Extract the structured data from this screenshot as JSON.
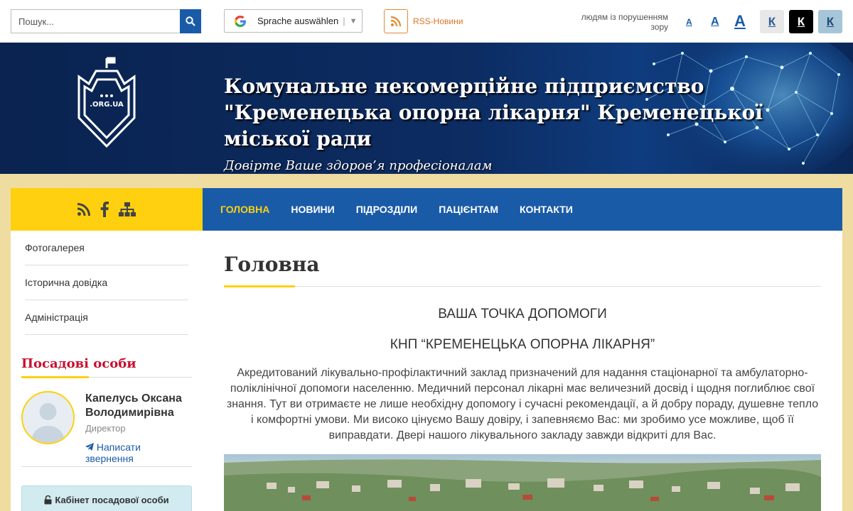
{
  "topbar": {
    "search_placeholder": "Пошук...",
    "translate_label": "Sprache auswählen",
    "rss_label": "RSS-Новини",
    "vision_label": "людям із порушенням зору",
    "font_small": "A",
    "font_medium": "A",
    "font_large": "A",
    "contrast_default": "К",
    "contrast_black": "К",
    "contrast_blue": "К"
  },
  "banner": {
    "logo_text": ".ORG.UA",
    "title": "Комунальне некомерційне підприємство \"Кременецька опорна лікарня\" Кременецької міської ради",
    "subtitle": "Довірте Ваше здоров’я професіоналам"
  },
  "sidebar": {
    "menu": [
      "Фотогалерея",
      "Історична довідка",
      "Адміністрація"
    ],
    "officials_title": "Посадові особи",
    "official": {
      "name": "Капелусь Оксана Володимирівна",
      "position": "Директор",
      "write_label": "Написати звернення"
    },
    "cabinet_label": "Кабінет посадової особи"
  },
  "nav": {
    "items": [
      "ГОЛОВНА",
      "НОВИНИ",
      "ПІДРОЗДІЛИ",
      "ПАЦІЄНТАМ",
      "КОНТАКТИ"
    ]
  },
  "content": {
    "page_title": "Головна",
    "heading1": "ВАША ТОЧКА ДОПОМОГИ",
    "heading2": "КНП “КРЕМЕНЕЦЬКА ОПОРНА ЛІКАРНЯ”",
    "paragraph": "Акредитований лікувально-профілактичний заклад призначений для надання стаціонарної та амбулаторно-поліклінічної допомоги населенню. Медичний персонал лікарні має величезний досвід і щодня поглиблює свої знання. Тут ви отримаєте не лише необхідну допомогу і сучасні рекомендації, а й добру пораду, душевне тепло і комфортні умови. Ми високо цінуємо Вашу довіру, і запевняємо Вас: ми зробимо усе можливе, щоб її виправдати. Двері нашого лікувального закладу завжди відкриті для Вас."
  },
  "colors": {
    "primary_blue": "#1a5ba8",
    "accent_yellow": "#ffd00f",
    "officials_red": "#c8102e",
    "background": "#efdca0",
    "banner_dark": "#0a2350"
  },
  "icons": {
    "search": "search-icon",
    "google": "google-icon",
    "rss": "rss-icon",
    "facebook": "facebook-icon",
    "sitemap": "sitemap-icon",
    "send": "send-icon",
    "lock": "lock-icon"
  }
}
